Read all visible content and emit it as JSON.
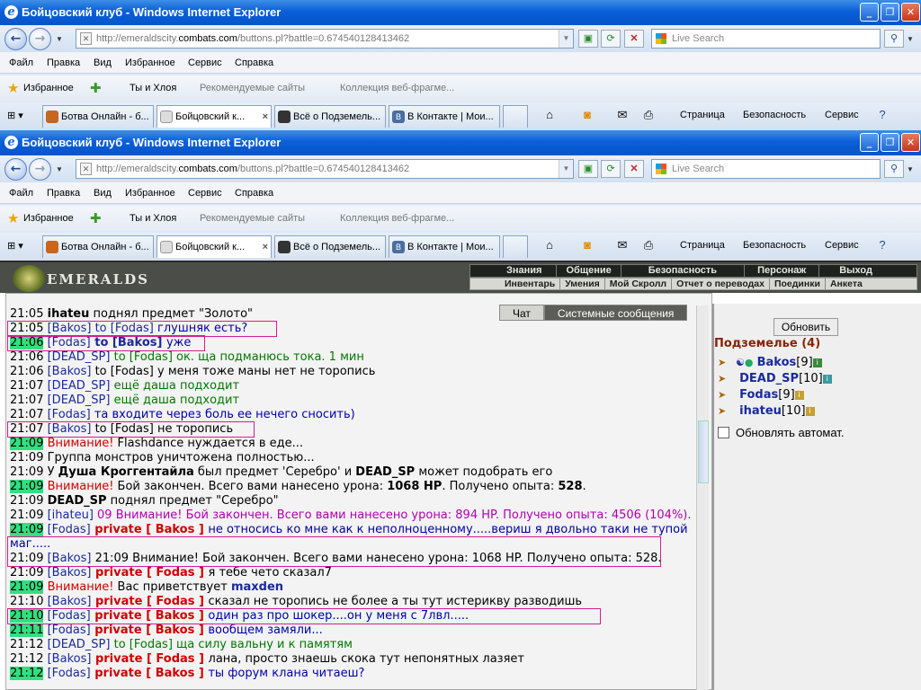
{
  "browser": {
    "title": "Бойцовский клуб - Windows Internet Explorer",
    "address_prefix": "http://emeraldscity.",
    "address_domain": "combats.com",
    "address_suffix": "/buttons.pl?battle=0.674540128413462",
    "search_placeholder": "Live Search",
    "menu": [
      "Файл",
      "Правка",
      "Вид",
      "Избранное",
      "Сервис",
      "Справка"
    ],
    "favorites_label": "Избранное",
    "fav_links": [
      "Ты и Хлоя",
      "Рекомендуемые сайты",
      "Коллекция веб-фрагме..."
    ],
    "tabs": [
      "Ботва Онлайн - б...",
      "Бойцовский к...",
      "Всё о Подземель...",
      "В Контакте | Мои..."
    ],
    "toolbar": {
      "page": "Страница",
      "security": "Безопасность",
      "tools": "Сервис"
    }
  },
  "game": {
    "brand": "EMERALDS",
    "top_nav": [
      "Знания",
      "Общение",
      "Безопасность",
      "Персонаж",
      "Выход"
    ],
    "sub_nav": [
      "Инвентарь",
      "Умения",
      "Мой Скролл",
      "Отчет о переводах",
      "Поединки",
      "Анкета"
    ],
    "chat_tabs": {
      "chat": "Чат",
      "system": "Системные сообщения"
    },
    "side_panel": {
      "refresh_button": "Обновить",
      "location": "Подземелье (4)",
      "players": [
        {
          "name": "Bakos",
          "level": "[9]"
        },
        {
          "name": "DEAD_SP",
          "level": "[10]"
        },
        {
          "name": "Fodas",
          "level": "[9]"
        },
        {
          "name": "ihateu",
          "level": "[10]"
        }
      ],
      "auto_refresh": "Обновлять автомат."
    }
  },
  "chat": {
    "l1": {
      "time": "21:05",
      "name": "ihateu",
      "text": " поднял предмет \"Золото\""
    },
    "l2": {
      "time": "21:05",
      "name": "[Bakos]",
      "mid": " to [Fodas] ",
      "text": "глушняк есть?"
    },
    "l3": {
      "time": "21:06",
      "name": "[Fodas]",
      "mid": " to [Bakos] ",
      "text": "уже"
    },
    "l4": {
      "time": "21:06",
      "name": "[DEAD_SP]",
      "mid": " to [Fodas] ",
      "text": "ок. ща подманюсь тока. 1 мин"
    },
    "l5": {
      "time": "21:06",
      "name": "[Bakos]",
      "mid": " to [Fodas] ",
      "text": "у меня тоже маны нет не торопись"
    },
    "l6": {
      "time": "21:07",
      "name": "[DEAD_SP]",
      "text": " ещё даша подходит"
    },
    "l7": {
      "time": "21:07",
      "name": "[DEAD_SP]",
      "text": " ещё даша подходит"
    },
    "l8": {
      "time": "21:07",
      "name": "[Fodas]",
      "text": " та входите через боль ее нечего сносить)"
    },
    "l9": {
      "time": "21:07",
      "name": "[Bakos]",
      "mid": " to [Fodas] ",
      "text": "не торопись"
    },
    "l10": {
      "time": "21:09",
      "warn": "Внимание!",
      "text": " Flashdance нуждается в еде..."
    },
    "l11": {
      "time": "21:09",
      "text": " Группа монстров уничтожена полностью..."
    },
    "l12": {
      "time": "21:09",
      "pre": " У ",
      "b1": "Душа Кроггентайла",
      "mid": " был предмет 'Серебро' и ",
      "b2": "DEAD_SP",
      "text": " может подобрать его"
    },
    "l13": {
      "time": "21:09",
      "warn": "Внимание!",
      "pre": " Бой закончен. Всего вами нанесено урона: ",
      "b1": "1068 HP",
      "mid": ". Получено опыта: ",
      "b2": "528",
      "text": "."
    },
    "l14": {
      "time": "21:09",
      "name": "DEAD_SP",
      "text": " поднял предмет \"Серебро\""
    },
    "l15": {
      "time": "21:09",
      "name": "[ihateu]",
      "text": " 09 Внимание! Бой закончен. Всего вами нанесено урона: 894 HP. Получено опыта: 4506 (104%)."
    },
    "l16": {
      "time": "21:09",
      "name": "[Fodas]",
      "priv": " private [ Bakos ] ",
      "text": "не относись ко мне как к неполноценному.....вериш я двольно таки не тупой маг....."
    },
    "l17": {
      "time": "21:09",
      "name": "[Bakos]",
      "text": " 21:09 Внимание! Бой закончен. Всего вами нанесено урона: 1068 HP. Получено опыта: 528."
    },
    "l18": {
      "time": "21:09",
      "name": "[Bakos]",
      "priv": " private [ Fodas ] ",
      "text": "я тебе чето сказал7"
    },
    "l19": {
      "time": "21:09",
      "warn": "Внимание!",
      "pre": " Вас приветствует ",
      "b1": "maxden"
    },
    "l20": {
      "time": "21:10",
      "name": "[Bakos]",
      "priv": " private [ Fodas ] ",
      "text": "сказал не торопись не более а ты тут истерикву разводишь"
    },
    "l21": {
      "time": "21:10",
      "name": "[Fodas]",
      "priv": " private [ Bakos ] ",
      "text": "один раз про шокер....он у меня с 7лвл....."
    },
    "l22": {
      "time": "21:11",
      "name": "[Fodas]",
      "priv": " private [ Bakos ] ",
      "text": "вообщем замяли..."
    },
    "l23": {
      "time": "21:12",
      "name": "[DEAD_SP]",
      "mid": " to [Fodas] ",
      "text": "ща силу вальну и к памятям"
    },
    "l24": {
      "time": "21:12",
      "name": "[Bakos]",
      "priv": " private [ Fodas ] ",
      "text": "лана, просто знаешь скока тут непонятных лазяет"
    },
    "l25": {
      "time": "21:12",
      "name": "[Fodas]",
      "priv": " private [ Bakos ] ",
      "text": "ты форум клана читаеш?"
    }
  }
}
